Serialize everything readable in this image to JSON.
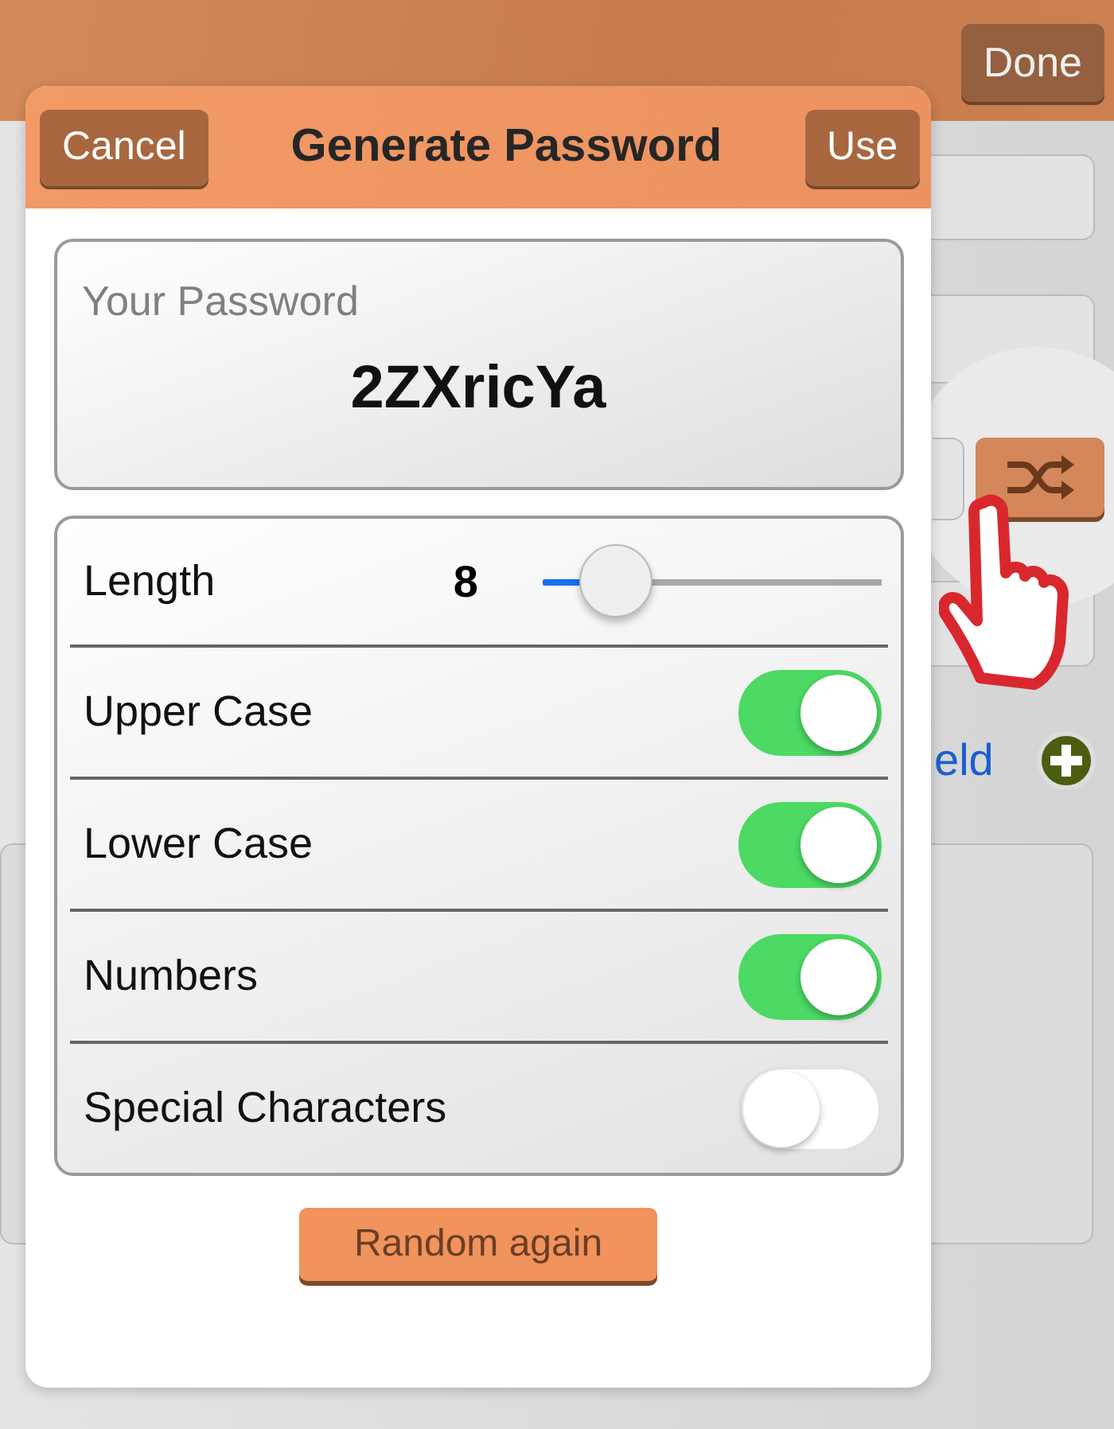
{
  "top_bar": {
    "done_button": "Done"
  },
  "background": {
    "link_text": "eld"
  },
  "dialog": {
    "title": "Generate Password",
    "cancel_button": "Cancel",
    "use_button": "Use",
    "password_label": "Your Password",
    "password": "2ZXricYa",
    "options": [
      {
        "kind": "slider",
        "label": "Length",
        "value": "8",
        "level": 0.22
      },
      {
        "kind": "toggle",
        "label": "Upper Case",
        "on": true
      },
      {
        "kind": "toggle",
        "label": "Lower Case",
        "on": true
      },
      {
        "kind": "toggle",
        "label": "Numbers",
        "on": true
      },
      {
        "kind": "toggle",
        "label": "Special Characters",
        "on": false
      }
    ],
    "random_button": "Random again"
  }
}
